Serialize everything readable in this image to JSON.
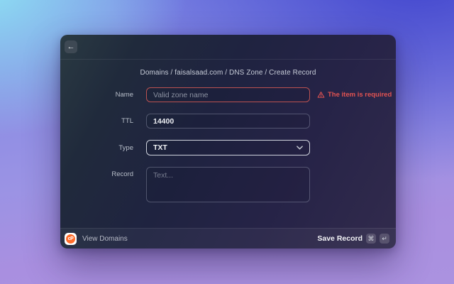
{
  "header": {
    "back_icon": "←",
    "breadcrumb": "Domains / faisalsaad.com / DNS Zone / Create Record"
  },
  "form": {
    "name": {
      "label": "Name",
      "placeholder": "Valid zone name",
      "error": "The item is required"
    },
    "ttl": {
      "label": "TTL",
      "value": "14400"
    },
    "type": {
      "label": "Type",
      "value": "TXT"
    },
    "record": {
      "label": "Record",
      "placeholder": "Text..."
    }
  },
  "footer": {
    "logo_text": "cP",
    "view_domains_label": "View Domains",
    "save_label": "Save Record",
    "shortcut_keys": [
      "⌘",
      "↵"
    ]
  },
  "icons": {
    "back": "back-arrow-icon",
    "warning": "warning-triangle-icon",
    "chevron": "chevron-down-icon",
    "command": "command-key-icon",
    "return": "return-key-icon"
  },
  "colors": {
    "error": "#e25351",
    "error_border": "#bc5251",
    "focus_border": "#ced2dc",
    "logo_orange": "#ff6c2c",
    "bg_cyan": "#8fe4f4",
    "bg_blue": "#3f43cd",
    "bg_lavender": "#a98fe0"
  }
}
